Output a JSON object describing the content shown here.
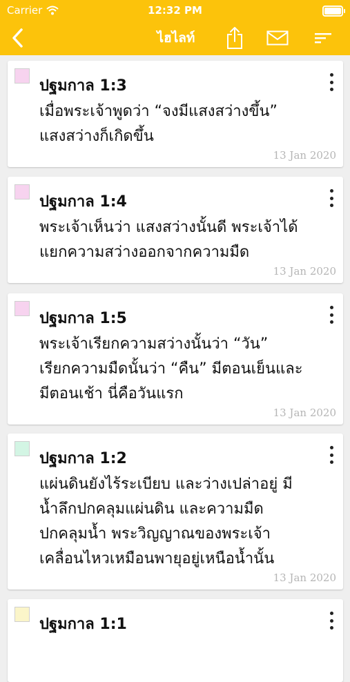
{
  "status": {
    "carrier": "Carrier",
    "time": "12:32 PM"
  },
  "nav": {
    "title": "ไฮไลท์"
  },
  "colors": {
    "accent": "#fcc30b",
    "pink": "#f7d3ef",
    "green": "#d3f5e4",
    "yellow": "#fbf5c9"
  },
  "notes": [
    {
      "reference": "ปฐมกาล 1:3",
      "line1": "เมื่อพระเจ้าพูดว่า “จงมีแสงสว่างขึ้น”",
      "line2": "แสงสว่างก็เกิดขึ้น",
      "line3": "",
      "line4": "",
      "date": "13 Jan 2020",
      "color": "#f7d3ef"
    },
    {
      "reference": "ปฐมกาล 1:4",
      "line1": "พระเจ้าเห็นว่า แสงสว่างนั้นดี พระเจ้าได้",
      "line2": "แยกความสว่างออกจากความมืด",
      "line3": "",
      "line4": "",
      "date": "13 Jan 2020",
      "color": "#f7d3ef"
    },
    {
      "reference": "ปฐมกาล 1:5",
      "line1": "พระเจ้าเรียกความสว่างนั้นว่า “วัน”",
      "line2": "เรียกความมืดนั้นว่า “คืน” มีตอนเย็นและ",
      "line3": "มีตอนเช้า นี่คือวันแรก",
      "line4": "",
      "date": "13 Jan 2020",
      "color": "#f7d3ef"
    },
    {
      "reference": "ปฐมกาล 1:2",
      "line1": "แผ่นดินยังไร้ระเบียบ และว่างเปล่าอยู่ มี",
      "line2": "น้ำลึกปกคลุมแผ่นดิน และความมืด",
      "line3": "ปกคลุมน้ำ พระวิญญาณของพระเจ้า",
      "line4": "เคลื่อนไหวเหมือนพายุอยู่เหนือน้ำนั้น",
      "date": "13 Jan 2020",
      "color": "#d3f5e4"
    },
    {
      "reference": "ปฐมกาล 1:1",
      "line1": "",
      "line2": "",
      "line3": "",
      "line4": "",
      "date": "",
      "color": "#fbf5c9"
    }
  ]
}
